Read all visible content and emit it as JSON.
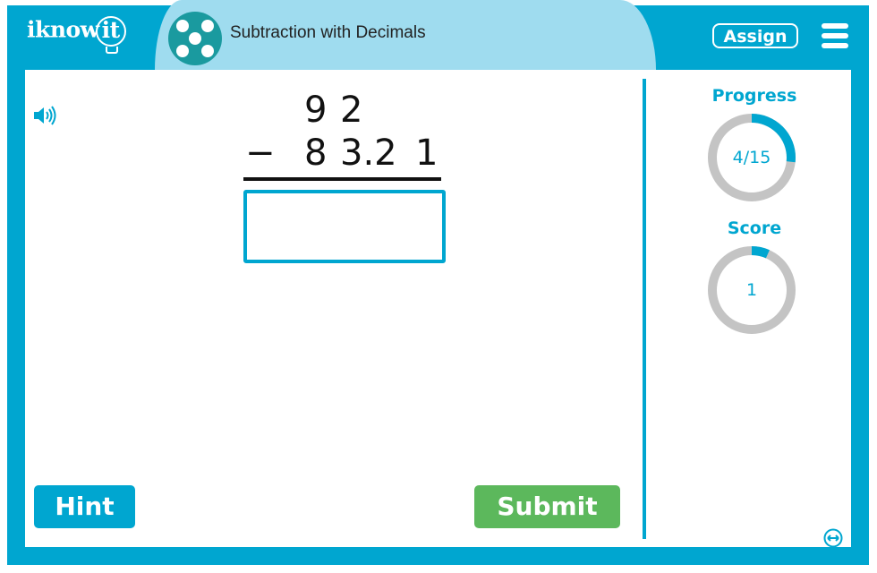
{
  "header": {
    "logo_text": "iknowit",
    "title": "Subtraction with Decimals",
    "assign_label": "Assign",
    "menu_icon": "hamburger-menu-icon",
    "topic_icon": "dice-five-icon"
  },
  "problem": {
    "operand_top": [
      "9",
      "2"
    ],
    "operator": "−",
    "operand_bottom": [
      "8",
      "3.2",
      "1"
    ],
    "answer_value": "",
    "speaker_icon": "speaker-icon"
  },
  "sidebar": {
    "progress": {
      "label": "Progress",
      "text": "4/15",
      "fraction": 0.2667
    },
    "score": {
      "label": "Score",
      "text": "1",
      "fraction": 0.0667
    }
  },
  "buttons": {
    "hint_label": "Hint",
    "submit_label": "Submit"
  },
  "footer": {
    "expand_icon": "expand-horizontal-icon"
  },
  "colors": {
    "primary": "#00a6d0",
    "title_bg": "#9fdcef",
    "submit": "#5cb85c",
    "ring_track": "#c4c4c4",
    "dice_bg": "#1a9a9f"
  }
}
